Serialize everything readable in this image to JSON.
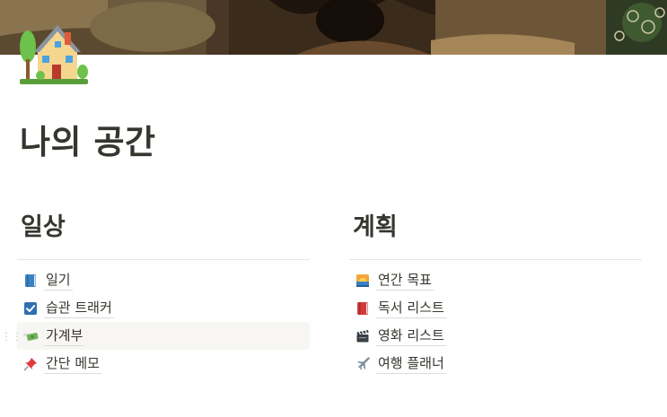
{
  "page": {
    "title": "나의 공간",
    "icon": "house-with-garden-icon",
    "cover": "painting-cover-image"
  },
  "columns": [
    {
      "heading": "일상",
      "items": [
        {
          "icon": "blue-book-icon",
          "label": "일기"
        },
        {
          "icon": "check-box-icon",
          "label": "습관 트래커"
        },
        {
          "icon": "money-with-wings-icon",
          "label": "가계부"
        },
        {
          "icon": "pushpin-icon",
          "label": "간단 메모"
        }
      ]
    },
    {
      "heading": "계획",
      "items": [
        {
          "icon": "sunrise-icon",
          "label": "연간 목표"
        },
        {
          "icon": "red-book-icon",
          "label": "독서 리스트"
        },
        {
          "icon": "clapper-board-icon",
          "label": "영화 리스트"
        },
        {
          "icon": "airplane-icon",
          "label": "여행 플래너"
        }
      ]
    }
  ],
  "colors": {
    "text": "#37352f",
    "divider": "#e4e3e0",
    "hover_row": "#f7f6f3"
  }
}
